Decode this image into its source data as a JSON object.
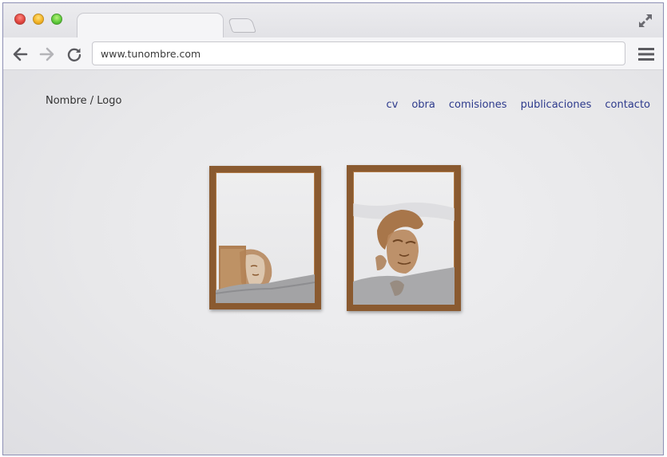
{
  "browser": {
    "url": "www.tunombre.com",
    "icons": {
      "close": "close-window-icon",
      "minimize": "minimize-window-icon",
      "zoom": "zoom-window-icon",
      "back": "back-arrow-icon",
      "forward": "forward-arrow-icon",
      "reload": "reload-icon",
      "fullscreen": "fullscreen-icon",
      "menu": "hamburger-menu-icon"
    }
  },
  "site": {
    "logo": "Nombre / Logo",
    "nav": [
      "cv",
      "obra",
      "comisiones",
      "publicaciones",
      "contacto"
    ],
    "nav_color": "#2d3a8c"
  },
  "colors": {
    "window_border": "#8d8fb4",
    "frame_wood": "#8a5a30",
    "wall": "#e8e8ea"
  }
}
